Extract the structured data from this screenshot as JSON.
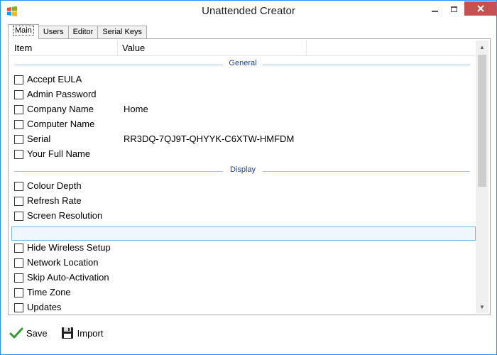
{
  "window": {
    "title": "Unattended Creator"
  },
  "tabs": [
    {
      "label": "Main",
      "active": true
    },
    {
      "label": "Users",
      "active": false
    },
    {
      "label": "Editor",
      "active": false
    },
    {
      "label": "Serial Keys",
      "active": false
    }
  ],
  "columns": {
    "item": "Item",
    "value": "Value"
  },
  "groups": {
    "general": {
      "label": "General",
      "items": [
        {
          "label": "Accept EULA",
          "value": "",
          "checked": false
        },
        {
          "label": "Admin Password",
          "value": "",
          "checked": false
        },
        {
          "label": "Company Name",
          "value": "Home",
          "checked": false
        },
        {
          "label": "Computer Name",
          "value": "",
          "checked": false
        },
        {
          "label": "Serial",
          "value": "RR3DQ-7QJ9T-QHYYK-C6XTW-HMFDM",
          "checked": false
        },
        {
          "label": "Your Full Name",
          "value": "",
          "checked": false
        }
      ]
    },
    "display": {
      "label": "Display",
      "items": [
        {
          "label": "Colour Depth",
          "value": "",
          "checked": false
        },
        {
          "label": "Refresh Rate",
          "value": "",
          "checked": false
        },
        {
          "label": "Screen Resolution",
          "value": "",
          "checked": false
        }
      ]
    },
    "other": {
      "items": [
        {
          "label": "Hide Wireless Setup",
          "value": "",
          "checked": false
        },
        {
          "label": "Network Location",
          "value": "",
          "checked": false
        },
        {
          "label": "Skip Auto-Activation",
          "value": "",
          "checked": false
        },
        {
          "label": "Time Zone",
          "value": "",
          "checked": false
        },
        {
          "label": "Updates",
          "value": "",
          "checked": false
        }
      ]
    }
  },
  "toolbar": {
    "save_label": "Save",
    "import_label": "Import"
  },
  "icons": {
    "app": "windows-logo-icon",
    "save": "checkmark-icon",
    "import": "floppy-disk-icon"
  },
  "colors": {
    "group_header_text": "#1e3f8f",
    "group_line": "#aac4e6",
    "selection_border": "#7ab6d6",
    "selection_fill": "#eef8fc",
    "close_button": "#c75050",
    "save_check": "#2e9e2e"
  }
}
